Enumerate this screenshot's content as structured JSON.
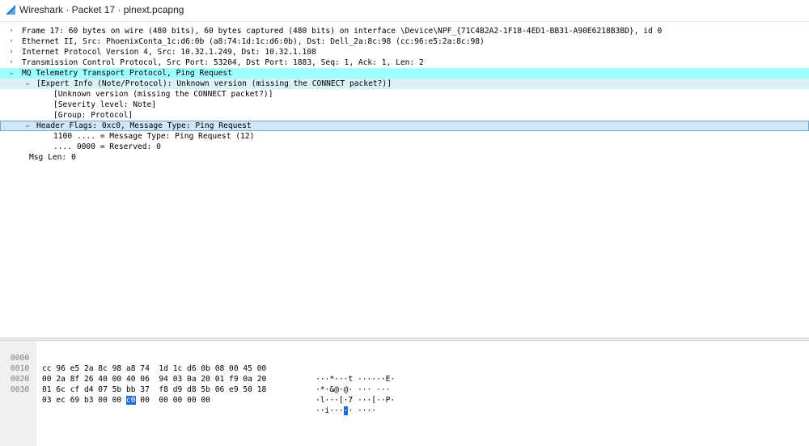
{
  "window": {
    "title": "Wireshark · Packet 17 · plnext.pcapng"
  },
  "tree": {
    "rows": [
      {
        "text": "Frame 17: 60 bytes on wire (480 bits), 60 bytes captured (480 bits) on interface \\Device\\NPF_{71C4B2A2-1F18-4ED1-BB31-A90E6218B3BD}, id 0",
        "toggle": "›"
      },
      {
        "text": "Ethernet II, Src: PhoenixConta_1c:d6:0b (a8:74:1d:1c:d6:0b), Dst: Dell_2a:8c:98 (cc:96:e5:2a:8c:98)",
        "toggle": "›"
      },
      {
        "text": "Internet Protocol Version 4, Src: 10.32.1.249, Dst: 10.32.1.108",
        "toggle": "›"
      },
      {
        "text": "Transmission Control Protocol, Src Port: 53204, Dst Port: 1883, Seq: 1, Ack: 1, Len: 2",
        "toggle": "›"
      },
      {
        "text": "MQ Telemetry Transport Protocol, Ping Request",
        "toggle": "⌄"
      },
      {
        "text": "[Expert Info (Note/Protocol): Unknown version (missing the CONNECT packet?)]",
        "toggle": "⌄"
      },
      {
        "text": "[Unknown version (missing the CONNECT packet?)]",
        "toggle": ""
      },
      {
        "text": "[Severity level: Note]",
        "toggle": ""
      },
      {
        "text": "[Group: Protocol]",
        "toggle": ""
      },
      {
        "text": "Header Flags: 0xc0, Message Type: Ping Request",
        "toggle": "⌄"
      },
      {
        "text": "1100 .... = Message Type: Ping Request (12)",
        "toggle": ""
      },
      {
        "text": ".... 0000 = Reserved: 0",
        "toggle": ""
      },
      {
        "text": "Msg Len: 0",
        "toggle": ""
      }
    ]
  },
  "bytes": {
    "rows": [
      {
        "offset": "0000",
        "hex": "cc 96 e5 2a 8c 98 a8 74  1d 1c d6 0b 08 00 45 00",
        "ascii": "···*···t ······E·"
      },
      {
        "offset": "0010",
        "hex": "00 2a 8f 26 40 00 40 06  94 03 0a 20 01 f9 0a 20",
        "ascii": "·*·&@·@· ··· ···"
      },
      {
        "offset": "0020",
        "hex": "01 6c cf d4 07 5b bb 37  f8 d9 d8 5b 06 e9 50 18",
        "ascii": "·l···[·7 ···[··P·"
      },
      {
        "offset": "0030",
        "hex_before": "03 ec 69 b3 00 00 ",
        "hex_sel": "c0",
        "hex_after": " 00  00 00 00 00",
        "ascii_before": "··i···",
        "ascii_sel": "·",
        "ascii_after": "· ····"
      }
    ]
  },
  "colors": {
    "mqtt_row": "#9effff",
    "selection": "#1e6bd6"
  }
}
